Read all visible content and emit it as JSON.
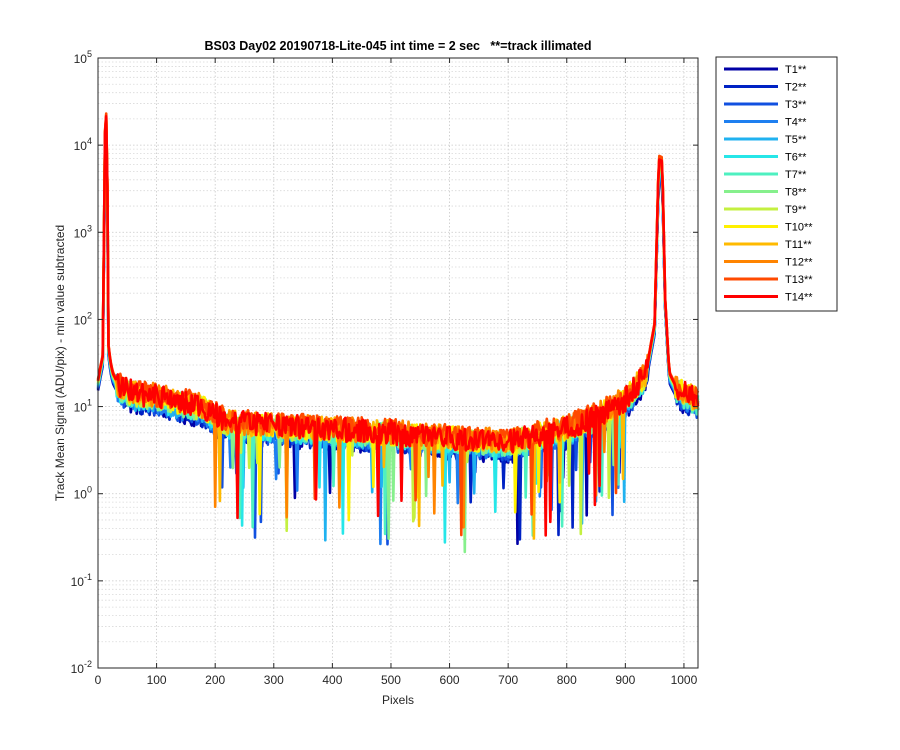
{
  "chart_data": {
    "type": "line",
    "title": "BS03 Day02 20190718-Lite-045 int time = 2 sec   **=track illimated",
    "xlabel": "Pixels",
    "ylabel": "Track Mean Signal (ADU/pix) - min value subtracted",
    "xlim": [
      0,
      1024
    ],
    "ylim": [
      0.01,
      100000
    ],
    "yscale": "log",
    "grid": true,
    "legend_position": "outside-right",
    "x_ticks": [
      "0",
      "100",
      "200",
      "300",
      "400",
      "500",
      "600",
      "700",
      "800",
      "900",
      "1000"
    ],
    "y_ticks": [
      {
        "base": "10",
        "exp": "-2"
      },
      {
        "base": "10",
        "exp": "-1"
      },
      {
        "base": "10",
        "exp": "0"
      },
      {
        "base": "10",
        "exp": "1"
      },
      {
        "base": "10",
        "exp": "2"
      },
      {
        "base": "10",
        "exp": "3"
      },
      {
        "base": "10",
        "exp": "4"
      },
      {
        "base": "10",
        "exp": "5"
      }
    ],
    "profile_x": [
      0,
      8,
      12,
      15,
      18,
      21,
      25,
      35,
      60,
      100,
      150,
      180,
      220,
      300,
      400,
      500,
      600,
      700,
      800,
      850,
      900,
      935,
      950,
      957,
      963,
      968,
      975,
      985,
      1000,
      1024
    ],
    "series": [
      {
        "name": "T1**",
        "color": "#0000a6",
        "peak1": 15000,
        "peak2": 4000,
        "level": 0.85
      },
      {
        "name": "T2**",
        "color": "#0022c4",
        "peak1": 17000,
        "peak2": 4300,
        "level": 0.88
      },
      {
        "name": "T3**",
        "color": "#1150e0",
        "peak1": 19000,
        "peak2": 4600,
        "level": 0.9
      },
      {
        "name": "T4**",
        "color": "#1e7ff0",
        "peak1": 20000,
        "peak2": 4900,
        "level": 0.93
      },
      {
        "name": "T5**",
        "color": "#20b2f0",
        "peak1": 21000,
        "peak2": 5200,
        "level": 0.95
      },
      {
        "name": "T6**",
        "color": "#26e6e8",
        "peak1": 22000,
        "peak2": 5500,
        "level": 0.98
      },
      {
        "name": "T7**",
        "color": "#4ef0c0",
        "peak1": 23000,
        "peak2": 5800,
        "level": 1.0
      },
      {
        "name": "T8**",
        "color": "#86f08c",
        "peak1": 24000,
        "peak2": 6100,
        "level": 1.02
      },
      {
        "name": "T9**",
        "color": "#c4f040",
        "peak1": 25000,
        "peak2": 6400,
        "level": 1.05
      },
      {
        "name": "T10**",
        "color": "#fff000",
        "peak1": 26000,
        "peak2": 6800,
        "level": 1.08
      },
      {
        "name": "T11**",
        "color": "#ffba00",
        "peak1": 27000,
        "peak2": 7100,
        "level": 1.1
      },
      {
        "name": "T12**",
        "color": "#ff8400",
        "peak1": 28000,
        "peak2": 7300,
        "level": 1.12
      },
      {
        "name": "T13**",
        "color": "#ff4a00",
        "peak1": 29000,
        "peak2": 7600,
        "level": 1.15
      },
      {
        "name": "T14**",
        "color": "#ff0000",
        "peak1": 27000,
        "peak2": 6900,
        "level": 1.1
      }
    ]
  }
}
